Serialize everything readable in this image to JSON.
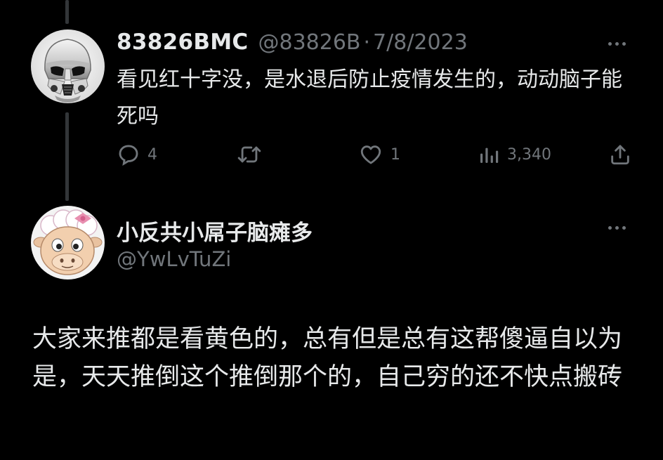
{
  "main_tweet": {
    "display_name": "83826BMC",
    "handle": "@83826B",
    "separator": "·",
    "date": "7/8/2023",
    "text": "看见红十字没，是水退后防止疫情发生的，动动脑子能死吗",
    "avatar_icon": "stormtrooper-avatar-icon",
    "actions": {
      "reply_count": "4",
      "retweet_count": "",
      "like_count": "1",
      "view_count": "3,340"
    }
  },
  "reply_tweet": {
    "display_name": "小反共小屌子脑瘫多",
    "handle": "@YwLvTuZi",
    "text": "大家来推都是看黄色的，总有但是总有这帮傻逼自以为是，天天推倒这个推倒那个的，自己穷的还不快点搬砖",
    "avatar_icon": "cartoon-sheep-avatar-icon"
  },
  "colors": {
    "background": "#000000",
    "primary_text": "#e7e9ea",
    "secondary_text": "#71767b",
    "thread_line": "#333639"
  }
}
